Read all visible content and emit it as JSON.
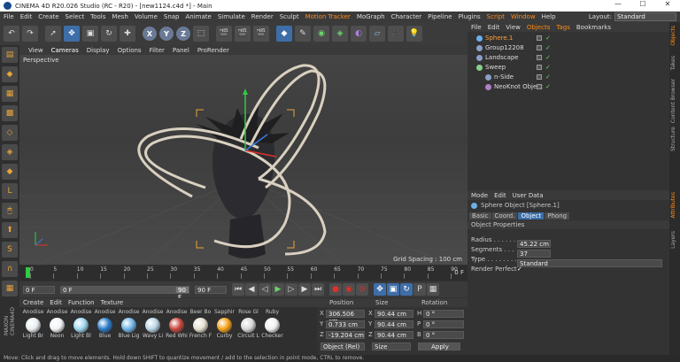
{
  "window": {
    "title": "CINEMA 4D R20.026 Studio (RC - R20) - [new1124.c4d *] - Main",
    "controls": [
      "—",
      "☐",
      "✕"
    ]
  },
  "menu": {
    "items": [
      "File",
      "Edit",
      "Create",
      "Select",
      "Tools",
      "Mesh",
      "Volume",
      "Snap",
      "Animate",
      "Simulate",
      "Render",
      "Sculpt",
      "Motion Tracker",
      "MoGraph",
      "Character",
      "Pipeline",
      "Plugins",
      "Script",
      "Window",
      "Help"
    ],
    "highlighted": [
      "Motion Tracker",
      "Script",
      "Window"
    ],
    "layout_label": "Layout:",
    "layout_value": "Standard"
  },
  "toolbar": {
    "icons": [
      "undo-icon",
      "live-select-icon",
      "move-icon",
      "scale-icon",
      "rotate-icon",
      "move-axis-icon"
    ],
    "axes": [
      "X",
      "Y",
      "Z"
    ]
  },
  "viewport": {
    "menu": [
      "View",
      "Cameras",
      "Display",
      "Options",
      "Filter",
      "Panel",
      "ProRender"
    ],
    "active_menu": "Cameras",
    "camera_label": "Perspective",
    "grid_spacing": "Grid Spacing : 100 cm"
  },
  "timeline": {
    "ticks": [
      "0",
      "5",
      "10",
      "15",
      "20",
      "25",
      "30",
      "35",
      "40",
      "45",
      "50",
      "55",
      "60",
      "65",
      "70",
      "75",
      "80",
      "85",
      "90"
    ],
    "end_label": "0 F",
    "start_field": "0 F",
    "frame_field": "0 F",
    "end_field": "90 F",
    "end_field2": "90 F"
  },
  "materials": {
    "menu": [
      "Create",
      "Edit",
      "Function",
      "Texture"
    ],
    "top_names": [
      "Anodise",
      "Anodise",
      "Anodise",
      "Anodise",
      "Anodise",
      "Anodise",
      "Anodise",
      "Beer Bo",
      "Sapphir",
      "Rose Gl",
      "Ruby"
    ],
    "items": [
      {
        "name": "Light Br",
        "color": "#e9eef2"
      },
      {
        "name": "Neon",
        "color": "#f2f4f6"
      },
      {
        "name": "Light Bl",
        "color": "#9fd8f0"
      },
      {
        "name": "Blue",
        "color": "#2c7cc9"
      },
      {
        "name": "Blue Lig",
        "color": "#72b6e8"
      },
      {
        "name": "Wavy Li",
        "color": "#b9d4e6"
      },
      {
        "name": "Red Whi",
        "color": "#c9483f"
      },
      {
        "name": "French F",
        "color": "#e6e0cf"
      },
      {
        "name": "Curby",
        "color": "#f4a21a"
      },
      {
        "name": "Circuit L",
        "color": "#d9d9d9"
      },
      {
        "name": "Checker",
        "color": "#f0f0f0"
      }
    ]
  },
  "coordinates": {
    "headers": [
      "Position",
      "Size",
      "Rotation"
    ],
    "rows": [
      {
        "axis": "X",
        "pos": "306.506 cm",
        "sizeAxis": "X",
        "size": "90.44 cm",
        "rotAxis": "H",
        "rot": "0 °"
      },
      {
        "axis": "Y",
        "pos": "0.733 cm",
        "sizeAxis": "Y",
        "size": "90.44 cm",
        "rotAxis": "P",
        "rot": "0 °"
      },
      {
        "axis": "Z",
        "pos": "-19.204 cm",
        "sizeAxis": "Z",
        "size": "90.44 cm",
        "rotAxis": "B",
        "rot": "0 °"
      }
    ],
    "mode": "Object (Rel)",
    "size_mode": "Size",
    "apply": "Apply"
  },
  "objects": {
    "tabs": [
      "File",
      "Edit",
      "View",
      "Objects",
      "Tags",
      "Bookmarks"
    ],
    "active_tab": "Objects",
    "items": [
      {
        "name": "Sphere.1",
        "indent": 0,
        "color": "#6ab0e8",
        "highlight": true
      },
      {
        "name": "Group12208",
        "indent": 0,
        "color": "#8aa0c8",
        "highlight": false
      },
      {
        "name": "Landscape",
        "indent": 0,
        "color": "#8aa0c8",
        "highlight": false
      },
      {
        "name": "Sweep",
        "indent": 0,
        "color": "#8ad08a",
        "highlight": false
      },
      {
        "name": "n-Side",
        "indent": 1,
        "color": "#8aa0c8",
        "highlight": false
      },
      {
        "name": "NeoKnot Object",
        "indent": 1,
        "color": "#b080c8",
        "highlight": false
      }
    ]
  },
  "attributes": {
    "menu": [
      "Mode",
      "Edit",
      "User Data"
    ],
    "object_title": "Sphere Object [Sphere.1]",
    "tabs": [
      "Basic",
      "Coord.",
      "Object",
      "Phong"
    ],
    "active_tab": "Object",
    "section": "Object Properties",
    "radius_label": "Radius . . . . . . .",
    "radius": "45.22 cm",
    "segments_label": "Segments . . . . .",
    "segments": "37",
    "type_label": "Type . . . . . . . . .",
    "type": "Standard",
    "render_perfect_label": "Render Perfect",
    "render_perfect": "✓"
  },
  "right_tabs": [
    "Objects",
    "Takes",
    "Content Browser",
    "Structure",
    "Attributes",
    "Layers"
  ],
  "status": "Move: Click and drag to move elements. Hold down SHIFT to quantize movement / add to the selection in point mode, CTRL to remove."
}
